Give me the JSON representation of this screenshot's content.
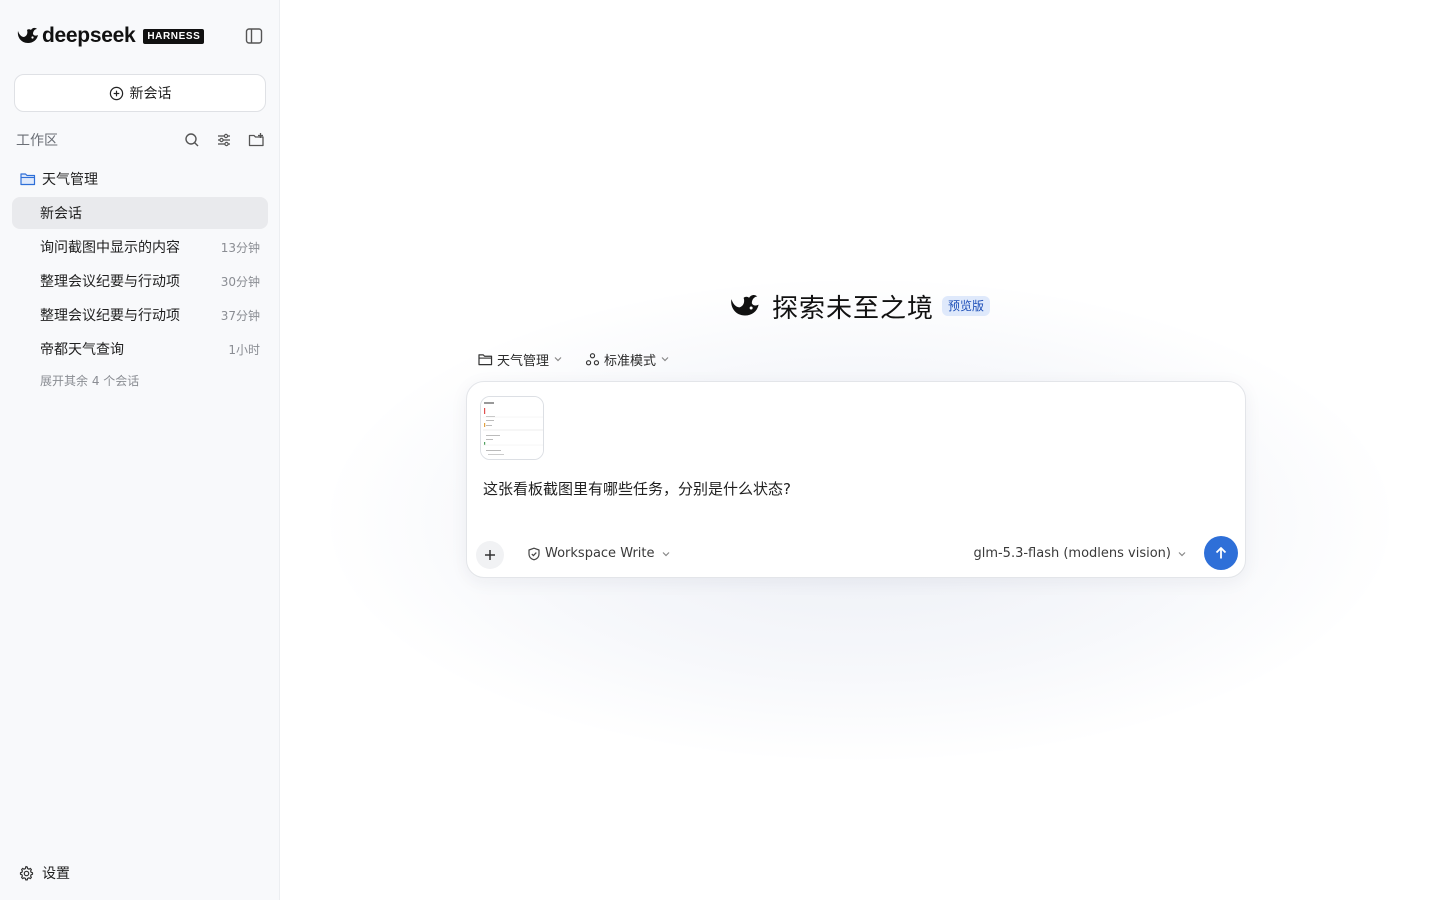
{
  "brand": {
    "name": "deepseek",
    "badge": "HARNESS"
  },
  "sidebar": {
    "new_chat_label": "新会话",
    "workspace_title": "工作区",
    "folder_name": "天气管理",
    "conversations": [
      {
        "label": "新会话",
        "time": "",
        "active": true
      },
      {
        "label": "询问截图中显示的内容",
        "time": "13分钟"
      },
      {
        "label": "整理会议纪要与行动项",
        "time": "30分钟"
      },
      {
        "label": "整理会议纪要与行动项",
        "time": "37分钟"
      },
      {
        "label": "帝都天气查询",
        "time": "1小时"
      }
    ],
    "expand_more": "展开其余 4 个会话",
    "settings_label": "设置"
  },
  "hero": {
    "title": "探索未至之境",
    "badge": "预览版"
  },
  "selectors": {
    "workspace": "天气管理",
    "mode": "标准模式"
  },
  "composer": {
    "prompt": "这张看板截图里有哪些任务，分别是什么状态?",
    "permission": "Workspace Write",
    "model": "glm-5.3-flash (modlens vision)"
  },
  "colors": {
    "accent": "#2e6fd8",
    "badge_bg": "#dfe9fb",
    "active_item": "#e9eaed"
  },
  "icons": [
    "whale-logo-icon",
    "sidebar-toggle-icon",
    "plus-circle-icon",
    "search-icon",
    "filter-icon",
    "new-folder-icon",
    "folder-icon",
    "gear-icon",
    "chevron-down-icon",
    "shield-icon",
    "plus-icon",
    "arrow-up-icon"
  ]
}
